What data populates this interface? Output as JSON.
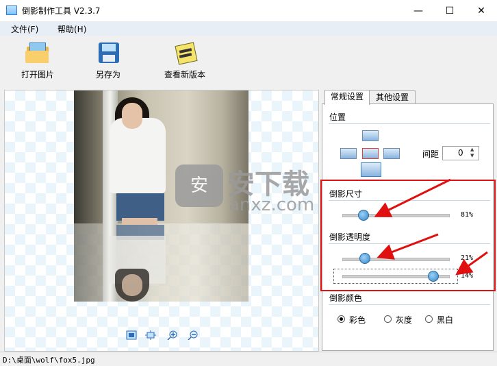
{
  "window": {
    "title": "倒影制作工具 V2.3.7",
    "minimize": "—",
    "maximize": "☐",
    "close": "✕"
  },
  "menu": {
    "file": "文件(F)",
    "help": "帮助(H)"
  },
  "toolbar": {
    "open": "打开图片",
    "save_as": "另存为",
    "check_update": "查看新版本"
  },
  "tabs": {
    "general": "常规设置",
    "other": "其他设置"
  },
  "position": {
    "title": "位置",
    "spacing_label": "间距",
    "spacing_value": "0",
    "spin_up": "▲",
    "spin_down": "▼"
  },
  "reflection_size": {
    "title": "倒影尺寸",
    "value_text": "81%",
    "value": 0.81
  },
  "reflection_opacity": {
    "title": "倒影透明度",
    "slider1_text": "21%",
    "slider1_value": 0.21,
    "slider2_text": "14%",
    "slider2_value": 0.14
  },
  "reflection_color": {
    "title": "倒影颜色",
    "opt_color": "彩色",
    "opt_gray": "灰度",
    "opt_black": "黑白",
    "selected": "彩色"
  },
  "watermark": {
    "badge": "安",
    "brand": "安下载",
    "sub": "anxz.com"
  },
  "statusbar": {
    "path": "D:\\桌面\\wolf\\fox5.jpg"
  },
  "colors": {
    "annotation_red": "#e01010",
    "slider_blue": "#2f86c9"
  }
}
